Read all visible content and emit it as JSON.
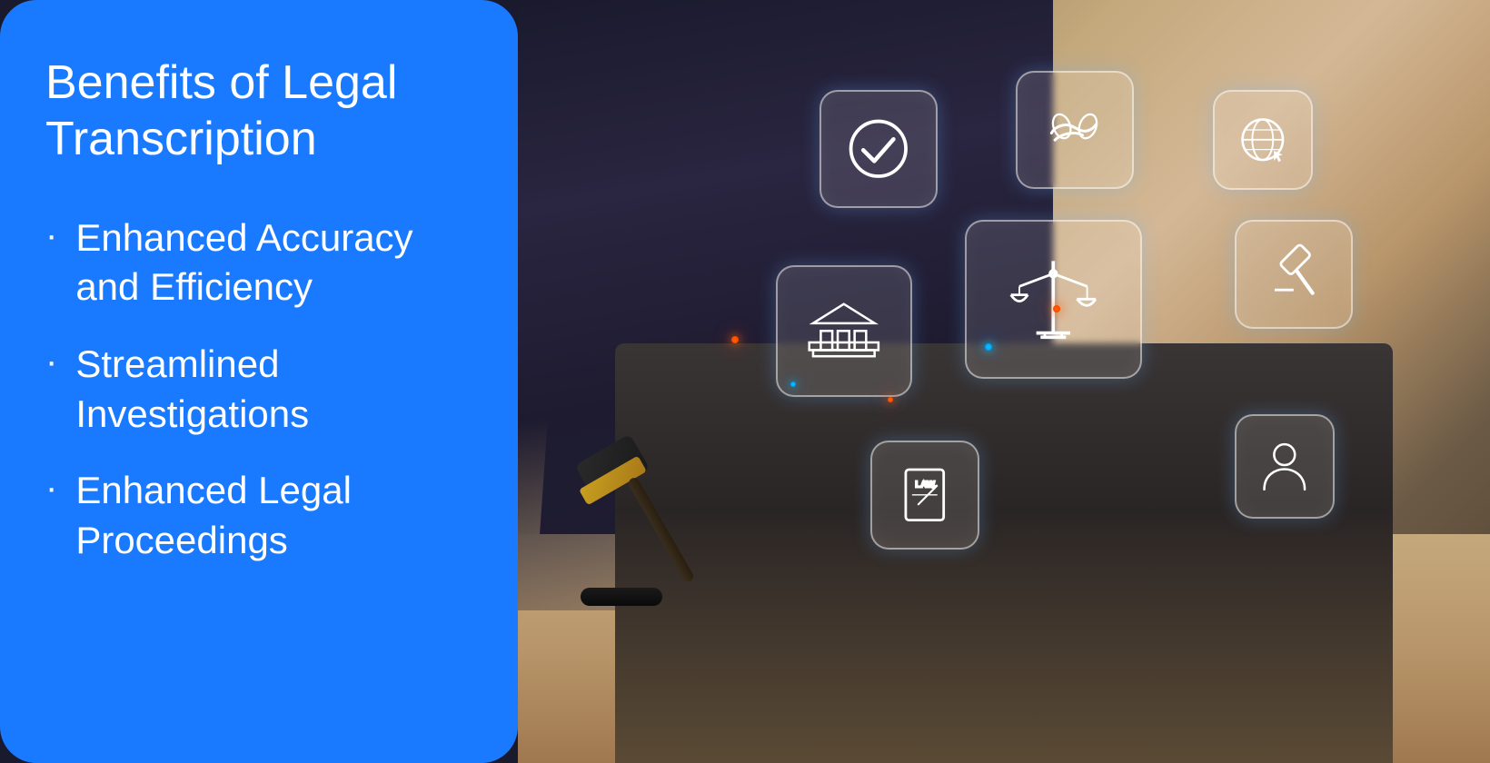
{
  "panel": {
    "title": "Benefits of Legal Transcription",
    "benefits": [
      {
        "bullet": "·",
        "line1": "Enhanced Accuracy",
        "line2": "and Efficiency"
      },
      {
        "bullet": "·",
        "line1": "Streamlined",
        "line2": "Investigations"
      },
      {
        "bullet": "·",
        "line1": "Enhanced Legal",
        "line2": "Proceedings"
      }
    ]
  },
  "image": {
    "description": "Legal professional using laptop with holographic legal icons"
  },
  "colors": {
    "panel_bg": "#1a7aff",
    "panel_text": "#ffffff",
    "accent_orange": "#ff6a00",
    "accent_blue": "#00cfff"
  }
}
